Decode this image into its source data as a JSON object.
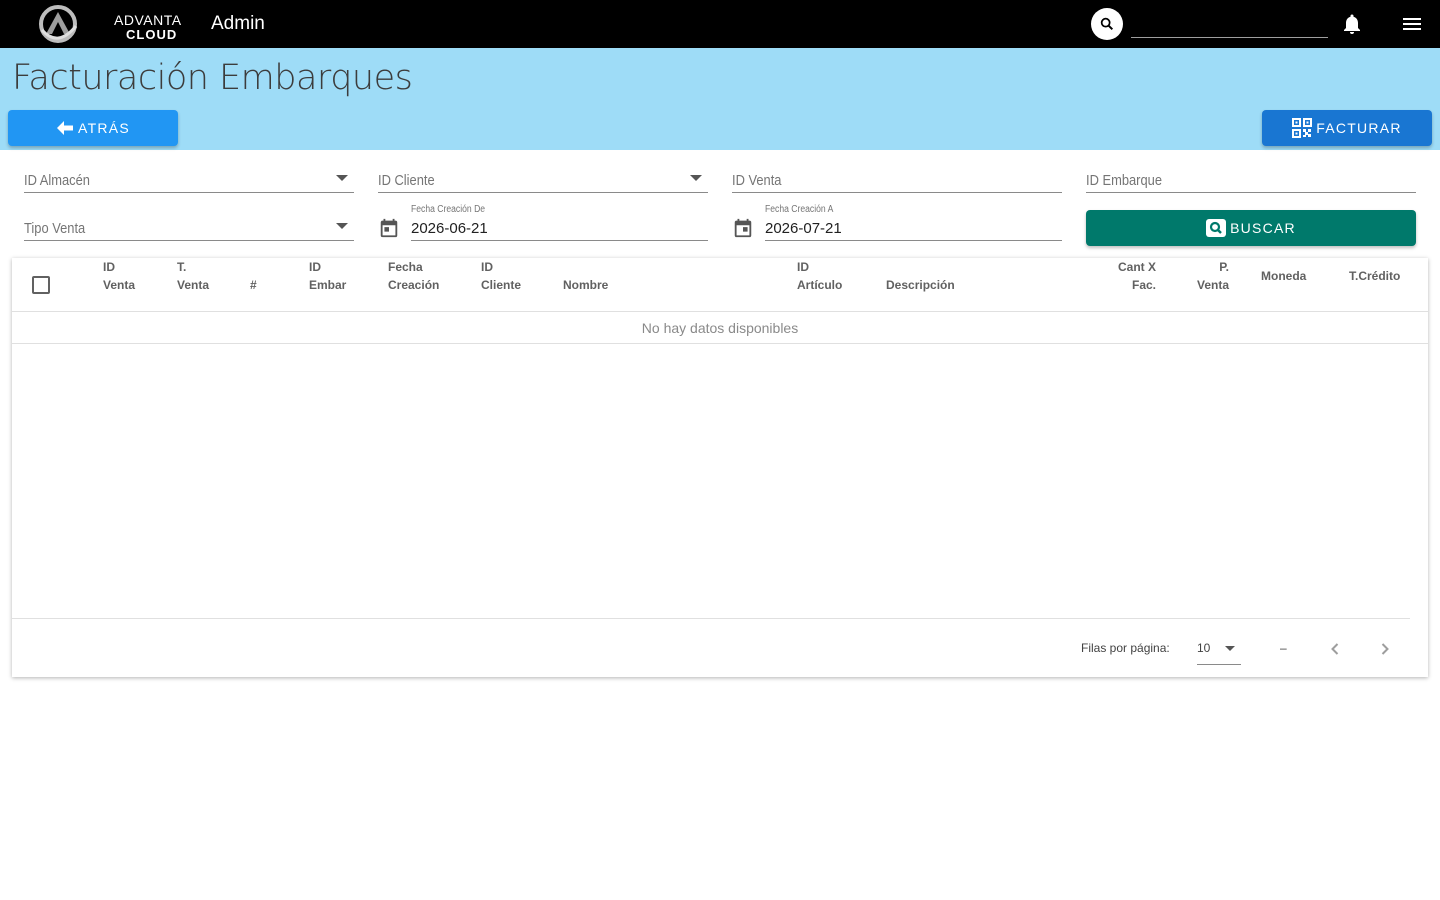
{
  "header": {
    "logo_line1": "ADVANTA",
    "logo_line2": "CLOUD",
    "app_title": "Admin",
    "search_placeholder": ""
  },
  "page": {
    "title": "Facturación Embarques",
    "back_label": "ATRÁS",
    "invoice_label": "FACTURAR"
  },
  "filters": {
    "warehouse_label": "ID Almacén",
    "client_label": "ID Cliente",
    "sale_id_label": "ID Venta",
    "shipment_id_label": "ID Embarque",
    "sale_type_label": "Tipo Venta",
    "date_from_label": "Fecha Creación De",
    "date_from_value": "2026-06-21",
    "date_to_label": "Fecha Creación A",
    "date_to_value": "2026-07-21",
    "search_label": "BUSCAR"
  },
  "table": {
    "columns": [
      {
        "l1": "ID",
        "l2": "Venta"
      },
      {
        "l1": "T.",
        "l2": "Venta"
      },
      {
        "l1": "",
        "l2": "#"
      },
      {
        "l1": "ID",
        "l2": "Embar"
      },
      {
        "l1": "Fecha",
        "l2": "Creación"
      },
      {
        "l1": "ID",
        "l2": "Cliente"
      },
      {
        "l1": "",
        "l2": "Nombre"
      },
      {
        "l1": "ID",
        "l2": "Artículo"
      },
      {
        "l1": "",
        "l2": "Descripción"
      },
      {
        "l1": "Cant X",
        "l2": "Fac."
      },
      {
        "l1": "P.",
        "l2": "Venta"
      },
      {
        "l1": "Moneda",
        "l2": ""
      },
      {
        "l1": "T.Crédito",
        "l2": ""
      }
    ],
    "empty_text": "No hay datos disponibles"
  },
  "pagination": {
    "rows_per_page_label": "Filas por página:",
    "rows_per_page_value": "10",
    "range_text": "–"
  },
  "colors": {
    "topbar": "#000000",
    "band": "#9edcf7",
    "back_button": "#2196f3",
    "invoice_button": "#1976d2",
    "search_button": "#00796b"
  },
  "icons": [
    "search-icon",
    "bell-icon",
    "menu-icon",
    "arrow-left-icon",
    "qr-code-icon",
    "calendar-icon",
    "chevron-left-icon",
    "chevron-right-icon"
  ]
}
